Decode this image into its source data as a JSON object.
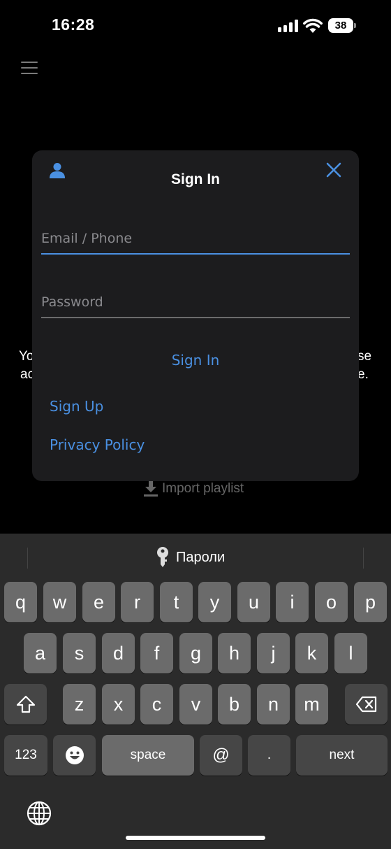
{
  "status_bar": {
    "time": "16:28",
    "battery": "38"
  },
  "background": {
    "line1_left": "Yo",
    "line1_right": "se",
    "line2_left": "ac",
    "line2_right": "e.",
    "import_playlist": "Import playlist"
  },
  "dialog": {
    "title": "Sign In",
    "email_placeholder": "Email / Phone",
    "email_value": "",
    "password_placeholder": "Password",
    "password_value": "",
    "sign_in_label": "Sign In",
    "sign_up_label": "Sign Up",
    "privacy_label": "Privacy Policy",
    "accent_color": "#4a90e2"
  },
  "keyboard": {
    "suggestion": "Пароли",
    "row1": [
      "q",
      "w",
      "e",
      "r",
      "t",
      "y",
      "u",
      "i",
      "o",
      "p"
    ],
    "row2": [
      "a",
      "s",
      "d",
      "f",
      "g",
      "h",
      "j",
      "k",
      "l"
    ],
    "row3": [
      "z",
      "x",
      "c",
      "v",
      "b",
      "n",
      "m"
    ],
    "numbers_label": "123",
    "space_label": "space",
    "at_label": "@",
    "dot_label": ".",
    "next_label": "next"
  },
  "icons": {
    "user": "user-icon",
    "close": "close-icon",
    "menu": "hamburger-menu-icon",
    "download": "download-icon",
    "key": "key-icon",
    "shift": "shift-icon",
    "backspace": "backspace-icon",
    "emoji": "emoji-icon",
    "globe": "globe-icon"
  }
}
